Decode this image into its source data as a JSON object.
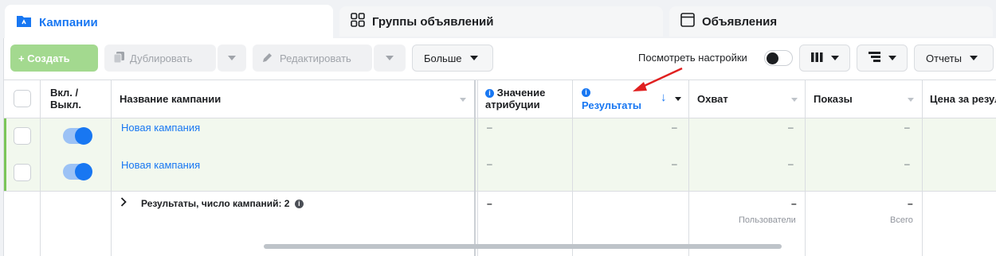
{
  "tabs": [
    {
      "label": "Кампании",
      "icon": "folder-icon"
    },
    {
      "label": "Группы объявлений",
      "icon": "grid-icon"
    },
    {
      "label": "Объявления",
      "icon": "ad-window-icon"
    }
  ],
  "toolbar": {
    "create_label": "+ Создать",
    "duplicate_label": "Дублировать",
    "edit_label": "Редактировать",
    "more_label": "Больше",
    "view_settings_label": "Посмотреть настройки",
    "reports_label": "Отчеты"
  },
  "columns": {
    "onoff": "Вкл. / Выкл.",
    "name": "Название кампании",
    "attribution": "Значение атрибуции",
    "results": "Результаты",
    "reach": "Охват",
    "impressions": "Показы",
    "cost": "Цена за результат"
  },
  "rows": [
    {
      "name": "Новая кампания",
      "attribution": "–",
      "results": "–",
      "reach": "–",
      "impressions": "–"
    },
    {
      "name": "Новая кампания",
      "attribution": "–",
      "results": "–",
      "reach": "–",
      "impressions": "–"
    }
  ],
  "summary": {
    "label": "Результаты, число кампаний: 2",
    "attribution": "–",
    "reach": "–",
    "reach_sub": "Пользователи",
    "impressions": "–",
    "impressions_sub": "Всего"
  },
  "colors": {
    "accent": "#1877f2",
    "create": "#a3d98f",
    "row_highlight": "#f2f8ee",
    "annotation_arrow": "#e02020"
  }
}
